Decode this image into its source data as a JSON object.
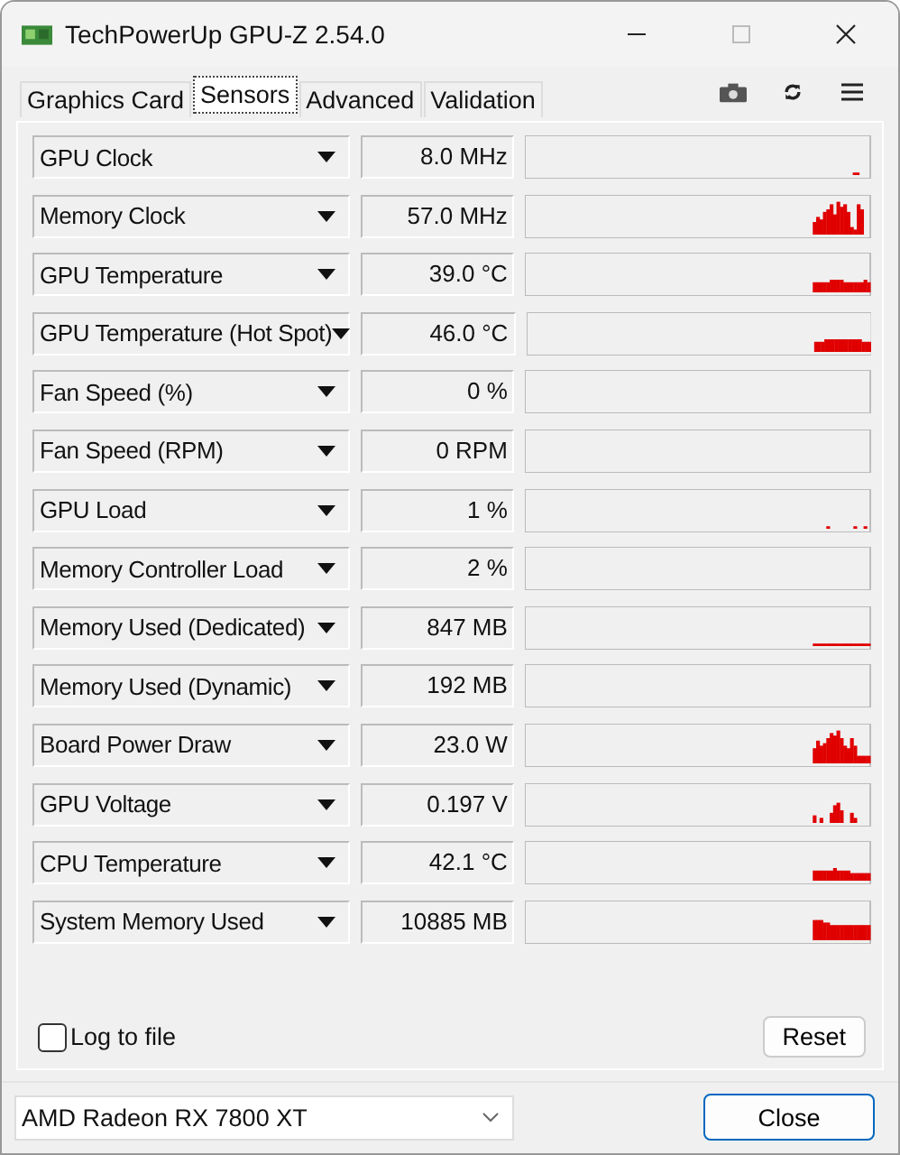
{
  "window": {
    "title": "TechPowerUp GPU-Z 2.54.0"
  },
  "tabs": [
    {
      "label": "Graphics Card",
      "selected": false
    },
    {
      "label": "Sensors",
      "selected": true
    },
    {
      "label": "Advanced",
      "selected": false
    },
    {
      "label": "Validation",
      "selected": false
    }
  ],
  "sensors": [
    {
      "name": "GPU Clock",
      "reading": "8.0 MHz"
    },
    {
      "name": "Memory Clock",
      "reading": "57.0 MHz"
    },
    {
      "name": "GPU Temperature",
      "reading": "39.0 °C"
    },
    {
      "name": "GPU Temperature (Hot Spot)",
      "reading": "46.0 °C"
    },
    {
      "name": "Fan Speed (%)",
      "reading": "0 %"
    },
    {
      "name": "Fan Speed (RPM)",
      "reading": "0 RPM"
    },
    {
      "name": "GPU Load",
      "reading": "1 %"
    },
    {
      "name": "Memory Controller Load",
      "reading": "2 %"
    },
    {
      "name": "Memory Used (Dedicated)",
      "reading": "847 MB"
    },
    {
      "name": "Memory Used (Dynamic)",
      "reading": "192 MB"
    },
    {
      "name": "Board Power Draw",
      "reading": "23.0 W"
    },
    {
      "name": "GPU Voltage",
      "reading": "0.197 V"
    },
    {
      "name": "CPU Temperature",
      "reading": "42.1 °C"
    },
    {
      "name": "System Memory Used",
      "reading": "10885 MB"
    }
  ],
  "log_to_file": {
    "label": "Log to file",
    "checked": false
  },
  "reset_button": "Reset",
  "gpu_select": {
    "value": "AMD Radeon RX 7800 XT"
  },
  "close_button": "Close"
}
